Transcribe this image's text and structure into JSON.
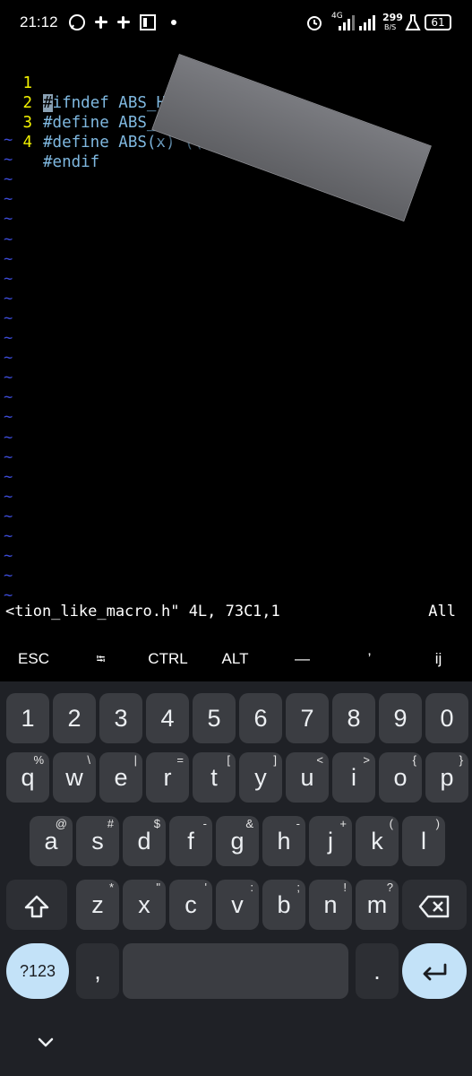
{
  "status_bar": {
    "time": "21:12",
    "net_speed_top": "299",
    "net_speed_bottom": "B/S",
    "battery": "61",
    "network": "4G"
  },
  "editor": {
    "lines": [
      {
        "num": "1",
        "cursor": "#",
        "code": "ifndef ABS_H"
      },
      {
        "num": "2",
        "cursor": "",
        "code": "#define ABS_H"
      },
      {
        "num": "3",
        "cursor": "",
        "code": "#define ABS(x) ((x) < 0 ? -(x) : (x))"
      },
      {
        "num": "4",
        "cursor": "",
        "code": "#endif"
      }
    ],
    "tilde": "~"
  },
  "vim_status": {
    "message": "<tion_like_macro.h\" 4L, 73C",
    "position": "1,1",
    "scroll": "All"
  },
  "extra_keys": [
    "ESC",
    "⭾",
    "CTRL",
    "ALT",
    "—",
    "’",
    "ij"
  ],
  "keyboard": {
    "row1": [
      "1",
      "2",
      "3",
      "4",
      "5",
      "6",
      "7",
      "8",
      "9",
      "0"
    ],
    "row2": [
      [
        "q",
        "%"
      ],
      [
        "w",
        "\\"
      ],
      [
        "e",
        "|"
      ],
      [
        "r",
        "="
      ],
      [
        "t",
        "["
      ],
      [
        "y",
        "]"
      ],
      [
        "u",
        "<"
      ],
      [
        "i",
        ">"
      ],
      [
        "o",
        "{"
      ],
      [
        "p",
        "}"
      ]
    ],
    "row3": [
      [
        "a",
        "@"
      ],
      [
        "s",
        "#"
      ],
      [
        "d",
        "$"
      ],
      [
        "f",
        "-"
      ],
      [
        "g",
        "&"
      ],
      [
        "h",
        "-"
      ],
      [
        "j",
        "+"
      ],
      [
        "k",
        "("
      ],
      [
        "l",
        ")"
      ]
    ],
    "row4": [
      [
        "z",
        "*"
      ],
      [
        "x",
        "\""
      ],
      [
        "c",
        "'"
      ],
      [
        "v",
        ":"
      ],
      [
        "b",
        ";"
      ],
      [
        "n",
        "!"
      ],
      [
        "m",
        "?"
      ]
    ],
    "symbols_label": "?123",
    "comma": ",",
    "period": ".",
    "colors": {
      "key": "#3b3d42",
      "bg": "#1f2126",
      "accent": "#c3e2f8"
    }
  }
}
